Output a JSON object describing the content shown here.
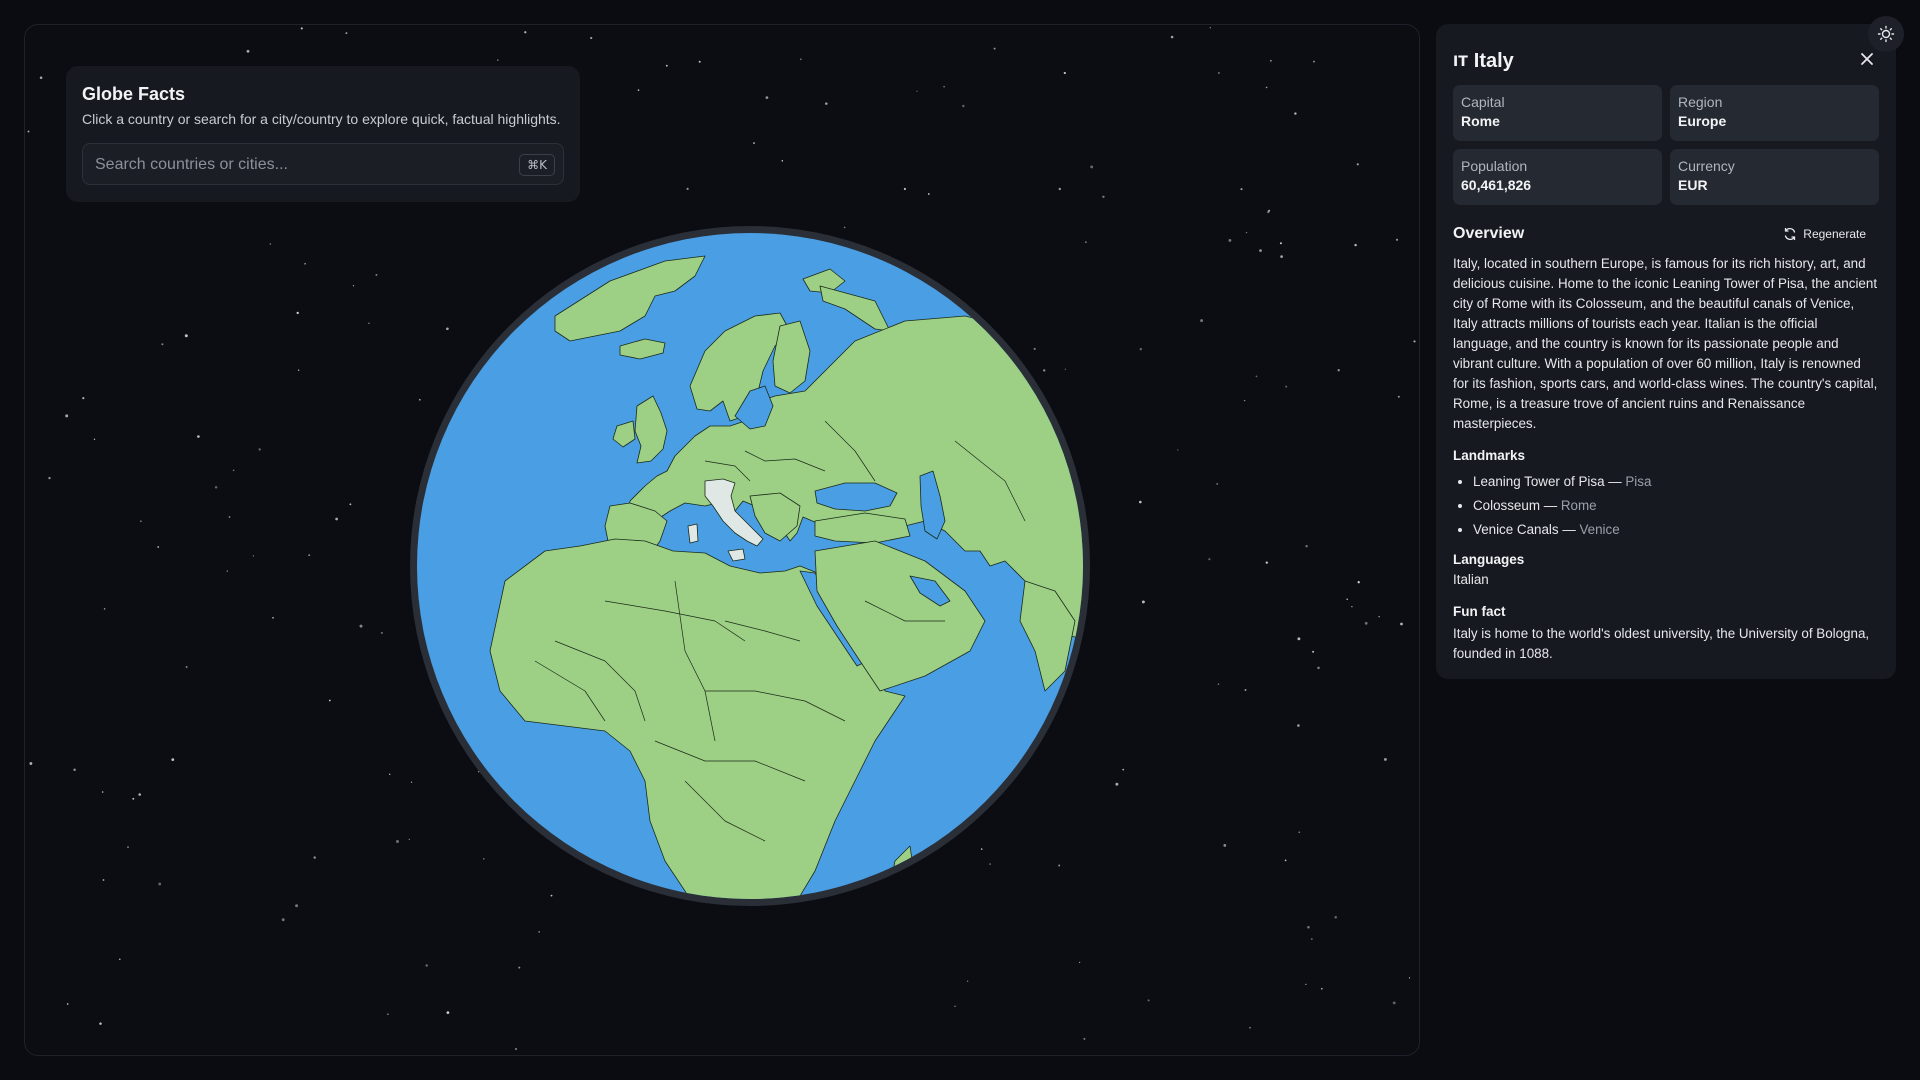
{
  "app": {
    "title": "Globe Facts",
    "subtitle": "Click a country or search for a city/country to explore quick, factual highlights."
  },
  "search": {
    "placeholder": "Search countries or cities...",
    "shortcut": "⌘K"
  },
  "colors": {
    "ocean": "#4a9ee3",
    "land": "#9dcf85",
    "selected_country": "#dfe8e4",
    "background": "#0a0c11",
    "panel": "#16191f"
  },
  "globe": {
    "selected_country": "Italy",
    "view_center": "Europe / Africa"
  },
  "panel": {
    "flag_code": "IT",
    "country": "Italy",
    "stats": [
      {
        "label": "Capital",
        "value": "Rome"
      },
      {
        "label": "Region",
        "value": "Europe"
      },
      {
        "label": "Population",
        "value": "60,461,826"
      },
      {
        "label": "Currency",
        "value": "EUR"
      }
    ],
    "overview_title": "Overview",
    "regenerate_label": "Regenerate",
    "overview": "Italy, located in southern Europe, is famous for its rich history, art, and delicious cuisine. Home to the iconic Leaning Tower of Pisa, the ancient city of Rome with its Colosseum, and the beautiful canals of Venice, Italy attracts millions of tourists each year. Italian is the official language, and the country is known for its passionate people and vibrant culture. With a population of over 60 million, Italy is renowned for its fashion, sports cars, and world-class wines. The country's capital, Rome, is a treasure trove of ancient ruins and Renaissance masterpieces.",
    "landmarks_title": "Landmarks",
    "landmarks": [
      {
        "name": "Leaning Tower of Pisa",
        "city": "Pisa"
      },
      {
        "name": "Colosseum",
        "city": "Rome"
      },
      {
        "name": "Venice Canals",
        "city": "Venice"
      }
    ],
    "languages_title": "Languages",
    "languages": "Italian",
    "fun_fact_title": "Fun fact",
    "fun_fact": "Italy is home to the world's oldest university, the University of Bologna, founded in 1088."
  }
}
